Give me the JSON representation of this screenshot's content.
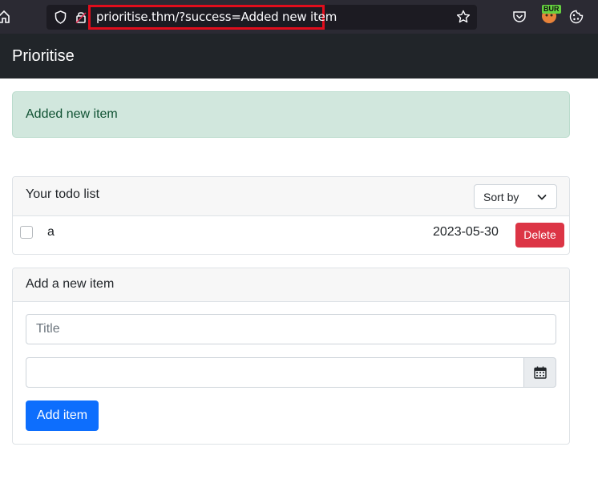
{
  "browser": {
    "url": "prioritise.thm/?success=Added new item",
    "burp_badge": "BUR",
    "icons": [
      "home-icon",
      "shield-icon",
      "lock-icon",
      "star-icon",
      "pocket-icon",
      "burp-icon",
      "cookie-icon"
    ]
  },
  "navbar": {
    "brand": "Prioritise"
  },
  "alert": {
    "message": "Added new item",
    "color": "#d1e7dd"
  },
  "todo_list": {
    "title": "Your todo list",
    "sort_label": "Sort by",
    "items": [
      {
        "title": "a",
        "date": "2023-05-30",
        "delete_label": "Delete",
        "checked": false
      }
    ]
  },
  "add_item": {
    "title": "Add a new item",
    "title_placeholder": "Title",
    "date_value": "",
    "submit_label": "Add item",
    "accent_color": "#0d6efd"
  },
  "colors": {
    "navbar": "#212529",
    "danger": "#dc3545",
    "primary": "#0d6efd"
  }
}
